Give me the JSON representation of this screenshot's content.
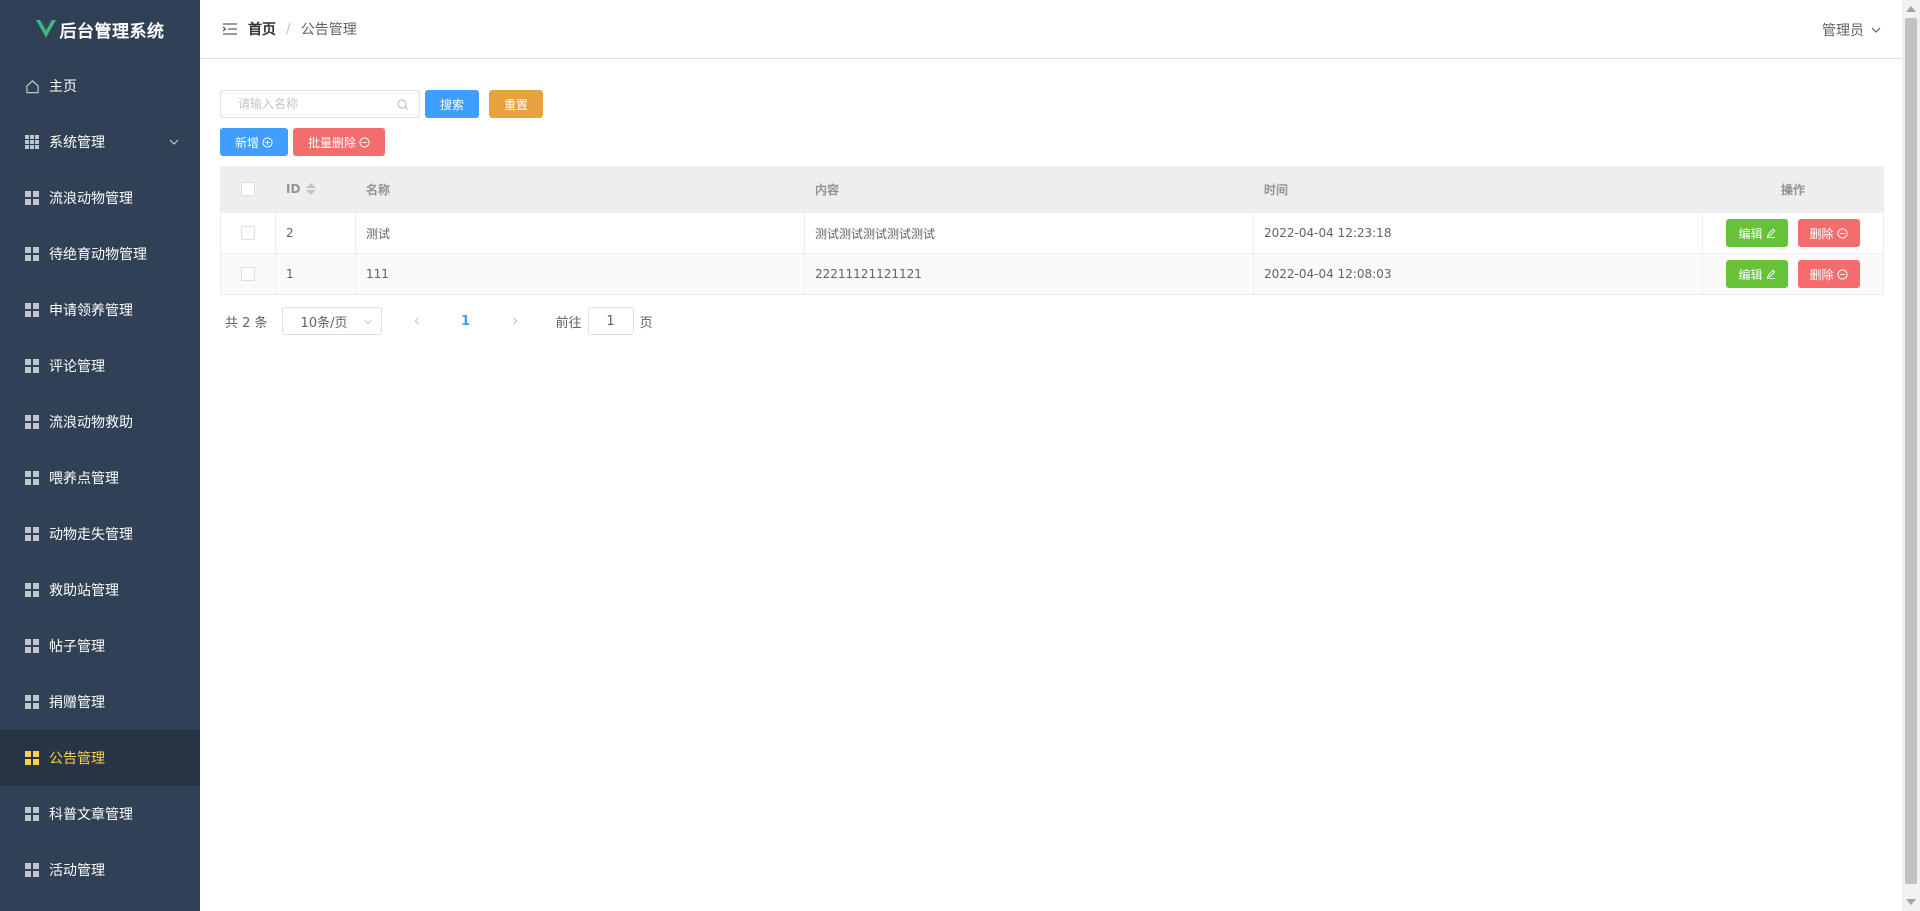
{
  "app": {
    "logo_text": "后台管理系统",
    "brand_color": "#41b883"
  },
  "sidebar": {
    "items": [
      {
        "label": "主页",
        "icon": "home-icon"
      },
      {
        "label": "系统管理",
        "icon": "grid-icon",
        "has_submenu": true
      },
      {
        "label": "流浪动物管理",
        "icon": "grid-icon"
      },
      {
        "label": "待绝育动物管理",
        "icon": "grid-icon"
      },
      {
        "label": "申请领养管理",
        "icon": "grid-icon"
      },
      {
        "label": "评论管理",
        "icon": "grid-icon"
      },
      {
        "label": "流浪动物救助",
        "icon": "grid-icon"
      },
      {
        "label": "喂养点管理",
        "icon": "grid-icon"
      },
      {
        "label": "动物走失管理",
        "icon": "grid-icon"
      },
      {
        "label": "救助站管理",
        "icon": "grid-icon"
      },
      {
        "label": "帖子管理",
        "icon": "grid-icon"
      },
      {
        "label": "捐赠管理",
        "icon": "grid-icon"
      },
      {
        "label": "公告管理",
        "icon": "grid-icon",
        "active": true
      },
      {
        "label": "科普文章管理",
        "icon": "grid-icon"
      },
      {
        "label": "活动管理",
        "icon": "grid-icon"
      }
    ],
    "active_color": "#ffd04b",
    "bg_color": "#304156"
  },
  "header": {
    "breadcrumb_home": "首页",
    "breadcrumb_sep": "/",
    "breadcrumb_current": "公告管理",
    "user_label": "管理员"
  },
  "toolbar": {
    "search_placeholder": "请输入名称",
    "search_value": "",
    "search_label": "搜索",
    "reset_label": "重置",
    "add_label": "新增",
    "batch_delete_label": "批量删除"
  },
  "table": {
    "columns": [
      "ID",
      "名称",
      "内容",
      "时间",
      "操作"
    ],
    "rows": [
      {
        "id": "2",
        "name": "测试",
        "content": "测试测试测试测试测试",
        "time": "2022-04-04 12:23:18"
      },
      {
        "id": "1",
        "name": "111",
        "content": "22211121121121",
        "time": "2022-04-04 12:08:03"
      }
    ],
    "edit_label": "编辑",
    "delete_label": "删除"
  },
  "pagination": {
    "total_text": "共 2 条",
    "page_size": "10条/页",
    "current_page": "1",
    "goto_prefix": "前往",
    "goto_value": "1",
    "goto_suffix": "页"
  }
}
